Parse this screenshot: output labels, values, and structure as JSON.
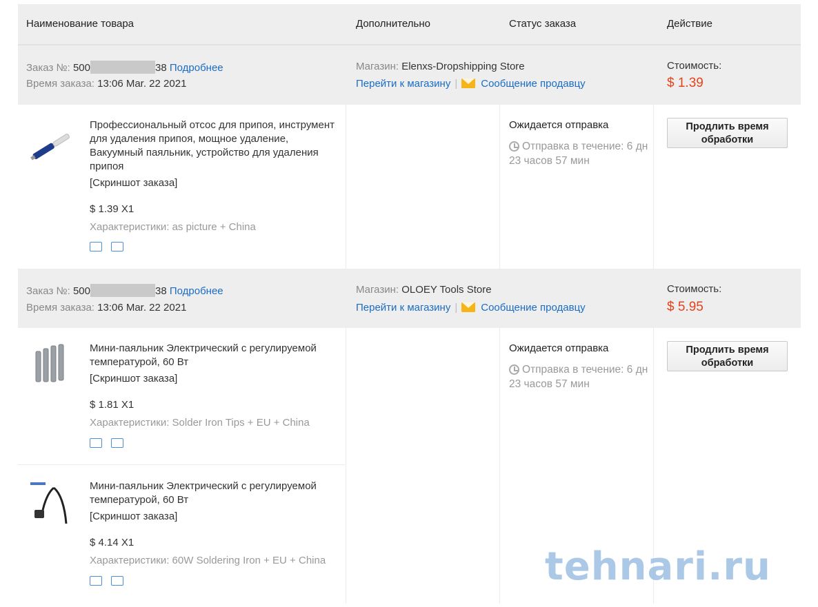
{
  "header": {
    "col_name": "Наименование товара",
    "col_extra": "Дополнительно",
    "col_status": "Статус заказа",
    "col_action": "Действие"
  },
  "orders": [
    {
      "order_label": "Заказ №:",
      "order_prefix": "500",
      "order_suffix": "38",
      "details_link": "Подробнее",
      "time_label": "Время заказа:",
      "time_value": "13:06 Mar. 22 2021",
      "store_label": "Магазин:",
      "store_name": "Elenxs-Dropshipping Store",
      "goto_store": "Перейти к магазину",
      "message_seller": "Сообщение продавцу",
      "cost_label": "Стоимость:",
      "cost_value": "$ 1.39",
      "status": "Ожидается отправка",
      "eta": "Отправка в течение: 6 дн 23 часов 57 мин",
      "action": "Продлить время обработки",
      "items": [
        {
          "title": "Профессиональный отсос для припоя, инструмент для удаления припоя, мощное удаление, Вакуумный паяльник, устройство для удаления припоя",
          "screenshot": "[Скриншот заказа]",
          "price": "$ 1.39 X1",
          "chars": "Характеристики: as picture + China"
        }
      ]
    },
    {
      "order_label": "Заказ №:",
      "order_prefix": "500",
      "order_suffix": "38",
      "details_link": "Подробнее",
      "time_label": "Время заказа:",
      "time_value": "13:06 Mar. 22 2021",
      "store_label": "Магазин:",
      "store_name": "OLOEY Tools Store",
      "goto_store": "Перейти к магазину",
      "message_seller": "Сообщение продавцу",
      "cost_label": "Стоимость:",
      "cost_value": "$ 5.95",
      "status": "Ожидается отправка",
      "eta": "Отправка в течение: 6 дн 23 часов 57 мин",
      "action": "Продлить время обработки",
      "items": [
        {
          "title": "Мини-паяльник Электрический с регулируемой температурой, 60 Вт",
          "screenshot": "[Скриншот заказа]",
          "price": "$ 1.81 X1",
          "chars": "Характеристики: Solder Iron Tips + EU + China"
        },
        {
          "title": "Мини-паяльник Электрический с регулируемой температурой, 60 Вт",
          "screenshot": "[Скриншот заказа]",
          "price": "$ 4.14 X1",
          "chars": "Характеристики: 60W Soldering Iron + EU + China"
        }
      ]
    }
  ],
  "watermark": "tehnari.ru",
  "colors": {
    "link": "#1a6cc4",
    "price": "#e4421a",
    "row_bg": "#eeeeee"
  }
}
